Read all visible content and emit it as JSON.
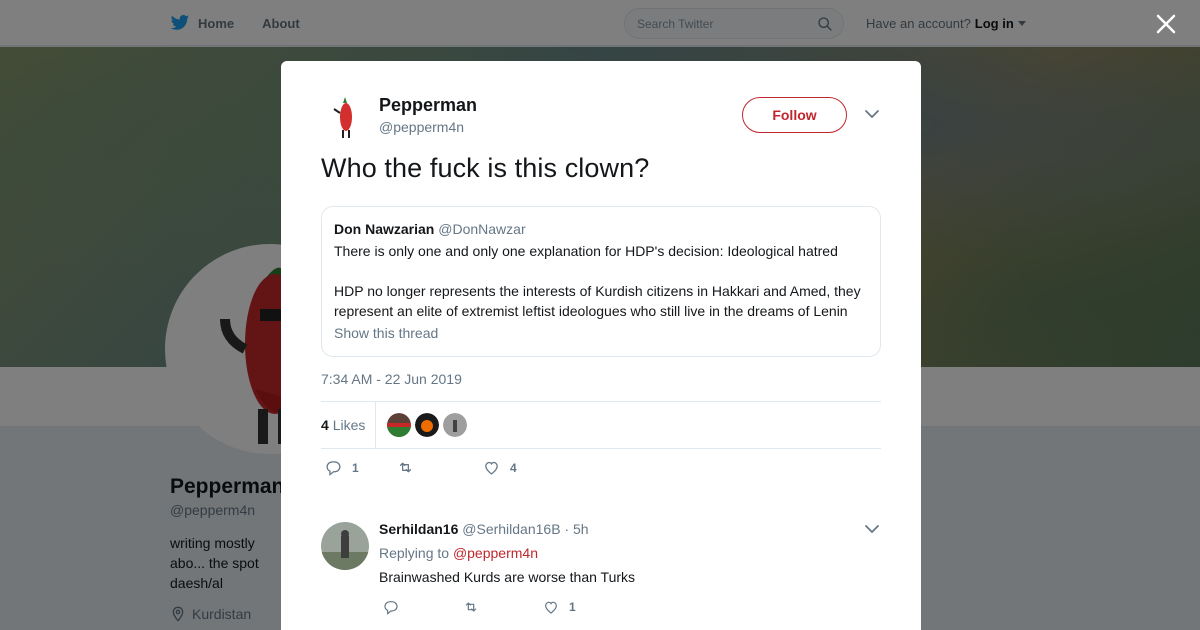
{
  "nav": {
    "home": "Home",
    "about": "About",
    "search_placeholder": "Search Twitter",
    "account_prompt": "Have an account?",
    "login": "Log in"
  },
  "profile": {
    "name": "Pepperman",
    "handle": "@pepperm4n",
    "bio": "writing mostly abo... the spot daesh/al qaeda/Akp/FSA/B...",
    "location": "Kurdistan"
  },
  "tweet": {
    "author_name": "Pepperman",
    "author_handle": "@pepperm4n",
    "follow_label": "Follow",
    "text": "Who the fuck is this clown?",
    "quote": {
      "author_name": "Don Nawzarian",
      "author_handle": "@DonNawzar",
      "paragraph1": "There is only one and only one explanation for HDP's decision: Ideological hatred",
      "paragraph2": "HDP no longer represents the interests of Kurdish citizens in Hakkari and Amed, they represent an elite of extremist leftist ideologues who still live in the dreams of Lenin",
      "show_thread": "Show this thread"
    },
    "timestamp": "7:34 AM - 22 Jun 2019",
    "likes_count": "4",
    "likes_label": "Likes",
    "reply_count": "1",
    "retweet_count": "",
    "like_count": "4"
  },
  "reply": {
    "name": "Serhildan16",
    "handle": "@Serhildan16B",
    "time": "· 5h",
    "replying_to_label": "Replying to",
    "replying_to_handle": "@pepperm4n",
    "text": "Brainwashed Kurds are worse than Turks",
    "reply_count": "",
    "retweet_count": "",
    "like_count": "1"
  },
  "colors": {
    "accent": "#c0272d",
    "twitter_blue": "#1da1f2",
    "muted": "#657786"
  }
}
